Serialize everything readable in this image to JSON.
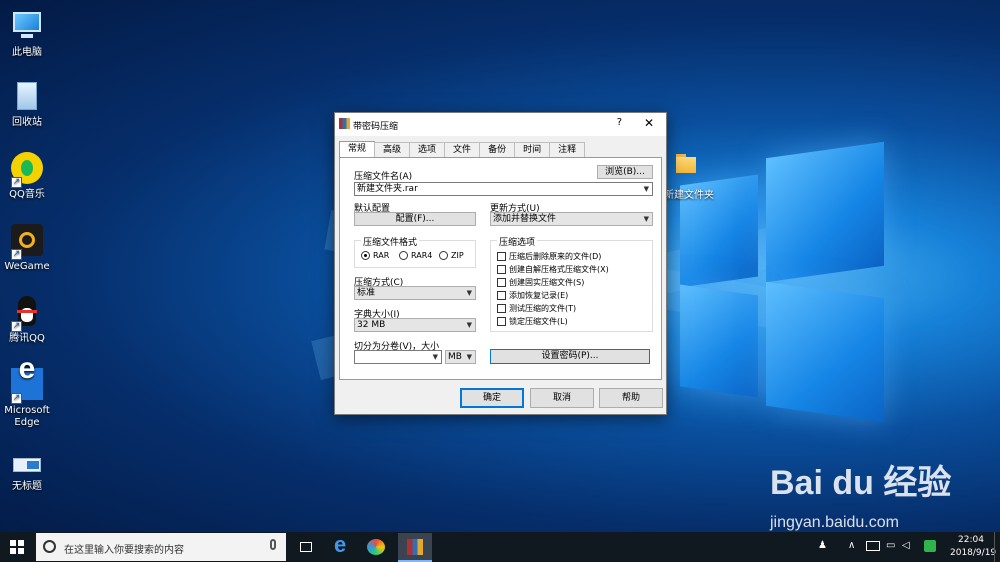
{
  "desktop": {
    "icons": [
      {
        "label": "此电脑",
        "icon": "computer-icon"
      },
      {
        "label": "回收站",
        "icon": "recycle-bin-icon"
      },
      {
        "label": "QQ音乐",
        "icon": "qq-music-icon"
      },
      {
        "label": "WeGame",
        "icon": "wegame-icon"
      },
      {
        "label": "腾讯QQ",
        "icon": "qq-icon"
      },
      {
        "label": "Microsoft Edge",
        "icon": "edge-icon"
      },
      {
        "label": "无标题",
        "icon": "untitled-icon"
      }
    ],
    "folder_label": "新建文件夹"
  },
  "dialog": {
    "title": "带密码压缩",
    "help_btn": "?",
    "close_btn": "✕",
    "tabs": [
      "常规",
      "高级",
      "选项",
      "文件",
      "备份",
      "时间",
      "注释"
    ],
    "archive_name_label": "压缩文件名(A)",
    "browse_btn": "浏览(B)...",
    "archive_name_value": "新建文件夹.rar",
    "default_profile_label": "默认配置",
    "profile_btn": "配置(F)...",
    "update_mode_label": "更新方式(U)",
    "update_mode_value": "添加并替换文件",
    "format_group": "压缩文件格式",
    "formats": [
      "RAR",
      "RAR4",
      "ZIP"
    ],
    "selected_format": "RAR",
    "method_label": "压缩方式(C)",
    "method_value": "标准",
    "dict_label": "字典大小(I)",
    "dict_value": "32 MB",
    "split_label": "切分为分卷(V)，大小",
    "split_value": "",
    "split_unit": "MB",
    "options_group": "压缩选项",
    "options": [
      "压缩后删除原来的文件(D)",
      "创建自解压格式压缩文件(X)",
      "创建固实压缩文件(S)",
      "添加恢复记录(E)",
      "测试压缩的文件(T)",
      "锁定压缩文件(L)"
    ],
    "set_password_btn": "设置密码(P)...",
    "ok_btn": "确定",
    "cancel_btn": "取消",
    "help_footer_btn": "帮助"
  },
  "taskbar": {
    "search_placeholder": "在这里输入你要搜索的内容",
    "time": "22:04",
    "date": "2018/9/19"
  },
  "watermark": {
    "brand": "Bai du 经验",
    "url": "jingyan.baidu.com"
  }
}
